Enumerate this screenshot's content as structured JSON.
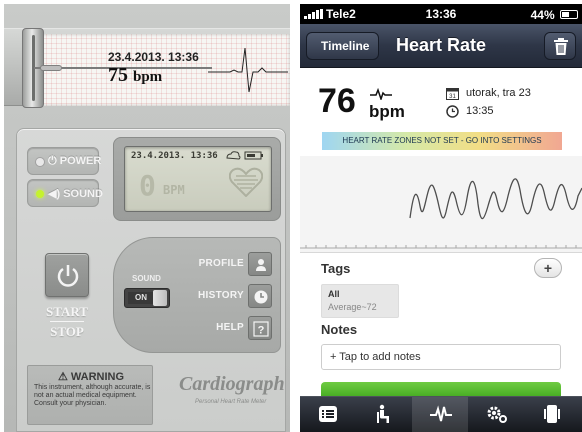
{
  "cardiograph": {
    "paper_date": "23.4.2013. 13:36",
    "paper_bpm_value": "75",
    "paper_bpm_unit": "bpm",
    "power_label": "POWER",
    "sound_label": "SOUND",
    "lcd_date": "23.4.2013. 13:36",
    "lcd_digits": "0",
    "lcd_unit": "BPM",
    "start_label": "START",
    "stop_label": "STOP",
    "sound_switch_label": "SOUND",
    "sound_switch_state": "ON",
    "profile_label": "PROFILE",
    "history_label": "HISTORY",
    "help_label": "HELP",
    "help_glyph": "?",
    "warning_title": "⚠ WARNING",
    "warning_text": "This instrument, although accurate, is not an actual medical equipment. Consult your physician.",
    "brand": "Cardiograph",
    "tagline": "Personal Heart Rate Meter",
    "colors": {
      "led_on": "#c5f22d",
      "body": "#c9cbc9"
    }
  },
  "phone": {
    "status": {
      "carrier": "Tele2",
      "time": "13:36",
      "battery": "44%",
      "battery_level": 0.44
    },
    "nav": {
      "back_label": "Timeline",
      "title": "Heart Rate",
      "trash_icon": "trash-icon"
    },
    "reading": {
      "value": "76",
      "unit": "bpm",
      "date": "utorak, tra 23",
      "time": "13:35",
      "calendar_day": "31"
    },
    "zones_banner": "HEART RATE ZONES NOT SET - GO INTO SETTINGS",
    "tags": {
      "label": "Tags",
      "add_label": "+",
      "items": [
        {
          "name": "All",
          "average": "Average~72"
        }
      ]
    },
    "notes": {
      "label": "Notes",
      "placeholder": "+ Tap to add notes"
    },
    "tabbar": [
      {
        "icon": "list-icon"
      },
      {
        "icon": "seated-person-icon"
      },
      {
        "icon": "heartbeat-icon",
        "active": true
      },
      {
        "icon": "settings-icon"
      },
      {
        "icon": "phone-icon"
      }
    ],
    "colors": {
      "nav": "#2e3647",
      "accent_green": "#4bb326",
      "zones": [
        "#9fd6f2",
        "#d5e9a8",
        "#f2de86",
        "#f1a792"
      ]
    }
  }
}
